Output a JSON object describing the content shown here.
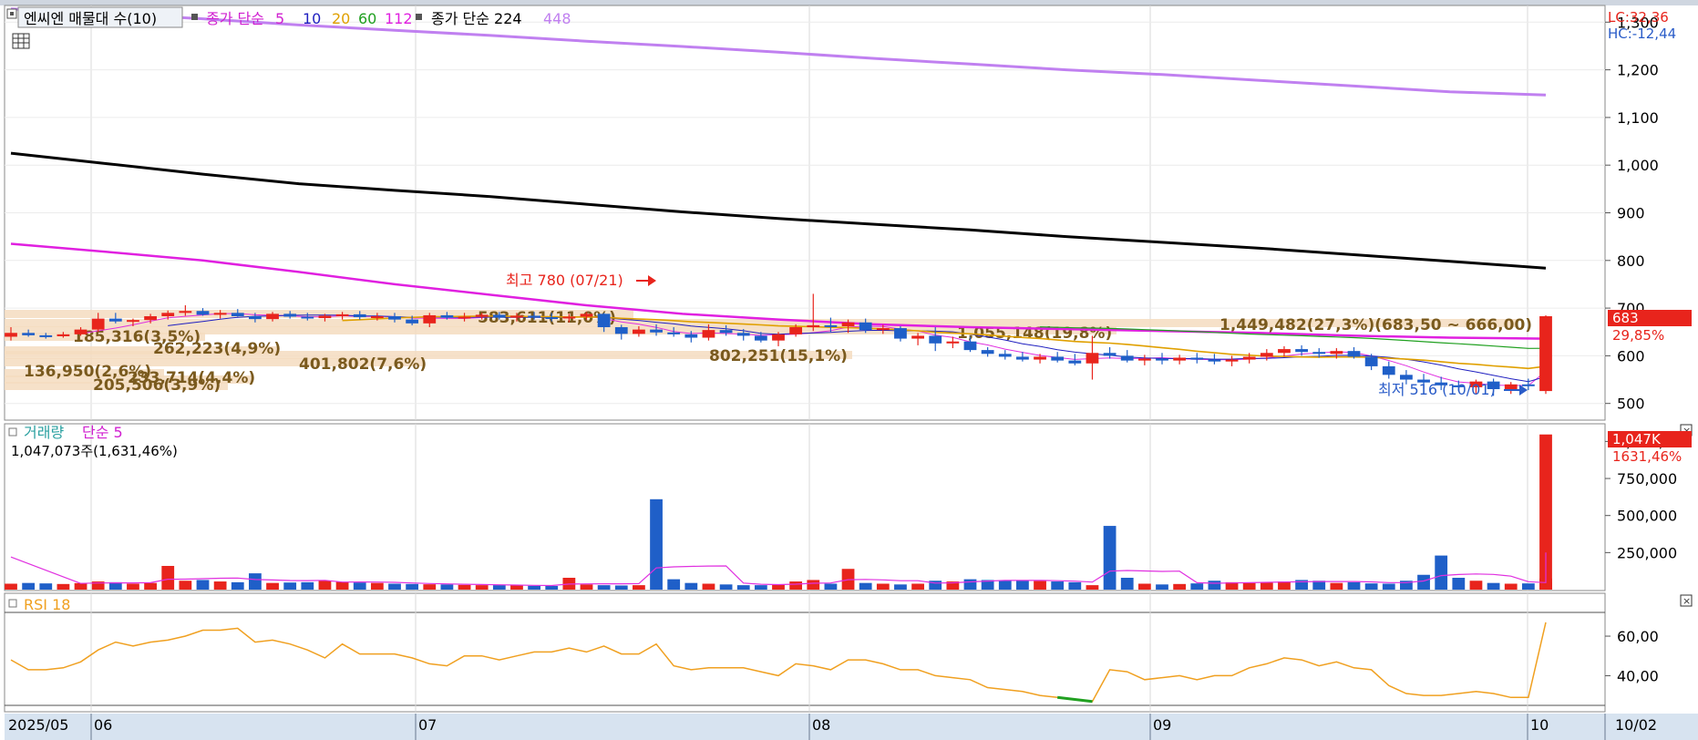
{
  "toolbar": {
    "price_title": "엔씨엔 매물대 수(10)",
    "ma_short_label": "종가 단순",
    "ma_periods": [
      "5",
      "10",
      "20",
      "60",
      "112"
    ],
    "ma_long_label": "종가 단순 224",
    "ma_long2": "448",
    "volume_title": "거래량",
    "volume_ma": "단순 5",
    "volume_info": "1,047,073주(1,631,46%)",
    "rsi_title": "RSI 18"
  },
  "readouts": {
    "lc": "LC:32,36",
    "hc": "HC:-12,44",
    "price_tag": "683",
    "price_pct": "29,85%",
    "volume_tag": "1,047K",
    "volume_pct": "1631,46%"
  },
  "colors": {
    "up": "#e8241c",
    "down": "#1f5fc8",
    "ma5": "#e030e0",
    "ma10": "#2020c0",
    "ma20": "#e0a000",
    "ma60": "#20a020",
    "ma112": "#e020e0",
    "ma224": "#000000",
    "ma448": "#c080f0",
    "rsi": "#f0a020",
    "profile": "#f5dcc0",
    "profile_label": "#7a5a1e",
    "tag": "#e8241c"
  },
  "chart_data": [
    {
      "type": "candlestick",
      "title": "엔씨엔",
      "x_axis_labels": [
        "2025/05",
        "06",
        "07",
        "08",
        "09",
        "10"
      ],
      "date_readout": "10/02",
      "ylim": [
        465,
        1335
      ],
      "y_ticks": [
        500,
        600,
        700,
        800,
        900,
        1000,
        1100,
        1200,
        1300
      ],
      "y_tick_labels": [
        "500",
        "600",
        "700",
        "800",
        "900",
        "1,000",
        "1,100",
        "1,200",
        "1,300"
      ],
      "candles": [
        [
          640,
          660,
          632,
          648
        ],
        [
          648,
          655,
          640,
          643
        ],
        [
          643,
          648,
          636,
          641
        ],
        [
          641,
          650,
          638,
          645
        ],
        [
          645,
          660,
          642,
          655
        ],
        [
          655,
          690,
          650,
          678
        ],
        [
          678,
          690,
          668,
          672
        ],
        [
          672,
          678,
          662,
          675
        ],
        [
          675,
          688,
          668,
          683
        ],
        [
          683,
          695,
          676,
          690
        ],
        [
          690,
          706,
          684,
          694
        ],
        [
          694,
          700,
          684,
          686
        ],
        [
          686,
          696,
          678,
          690
        ],
        [
          690,
          698,
          682,
          683
        ],
        [
          683,
          690,
          670,
          677
        ],
        [
          677,
          692,
          672,
          688
        ],
        [
          688,
          694,
          678,
          682
        ],
        [
          682,
          690,
          674,
          679
        ],
        [
          679,
          688,
          672,
          684
        ],
        [
          684,
          692,
          676,
          687
        ],
        [
          687,
          694,
          676,
          681
        ],
        [
          681,
          690,
          674,
          683
        ],
        [
          683,
          690,
          670,
          676
        ],
        [
          676,
          684,
          664,
          668
        ],
        [
          668,
          690,
          660,
          685
        ],
        [
          685,
          692,
          676,
          680
        ],
        [
          680,
          690,
          672,
          682
        ],
        [
          682,
          690,
          676,
          686
        ],
        [
          686,
          692,
          676,
          680
        ],
        [
          680,
          690,
          672,
          684
        ],
        [
          684,
          692,
          676,
          681
        ],
        [
          681,
          690,
          672,
          679
        ],
        [
          679,
          688,
          670,
          682
        ],
        [
          682,
          692,
          676,
          688
        ],
        [
          688,
          690,
          650,
          660
        ],
        [
          660,
          665,
          634,
          646
        ],
        [
          646,
          662,
          640,
          655
        ],
        [
          655,
          666,
          642,
          649
        ],
        [
          649,
          660,
          640,
          645
        ],
        [
          645,
          652,
          628,
          638
        ],
        [
          638,
          666,
          632,
          654
        ],
        [
          654,
          664,
          642,
          648
        ],
        [
          648,
          656,
          632,
          642
        ],
        [
          642,
          650,
          628,
          632
        ],
        [
          632,
          650,
          620,
          645
        ],
        [
          645,
          666,
          640,
          660
        ],
        [
          660,
          730,
          652,
          664
        ],
        [
          664,
          680,
          650,
          662
        ],
        [
          662,
          676,
          648,
          670
        ],
        [
          670,
          678,
          648,
          654
        ],
        [
          654,
          665,
          646,
          658
        ],
        [
          658,
          662,
          630,
          636
        ],
        [
          636,
          648,
          622,
          642
        ],
        [
          642,
          660,
          610,
          626
        ],
        [
          626,
          640,
          616,
          630
        ],
        [
          630,
          640,
          608,
          612
        ],
        [
          612,
          618,
          598,
          604
        ],
        [
          604,
          612,
          592,
          598
        ],
        [
          598,
          608,
          588,
          592
        ],
        [
          592,
          604,
          584,
          598
        ],
        [
          598,
          608,
          586,
          590
        ],
        [
          590,
          604,
          580,
          584
        ],
        [
          584,
          642,
          550,
          606
        ],
        [
          606,
          618,
          594,
          600
        ],
        [
          600,
          612,
          586,
          590
        ],
        [
          590,
          602,
          580,
          594
        ],
        [
          594,
          606,
          582,
          590
        ],
        [
          590,
          602,
          582,
          596
        ],
        [
          596,
          606,
          584,
          592
        ],
        [
          592,
          604,
          582,
          588
        ],
        [
          588,
          600,
          578,
          592
        ],
        [
          592,
          606,
          584,
          598
        ],
        [
          598,
          614,
          590,
          606
        ],
        [
          606,
          620,
          598,
          614
        ],
        [
          614,
          622,
          600,
          608
        ],
        [
          608,
          616,
          596,
          604
        ],
        [
          604,
          616,
          594,
          610
        ],
        [
          610,
          618,
          594,
          598
        ],
        [
          598,
          604,
          570,
          578
        ],
        [
          578,
          588,
          552,
          560
        ],
        [
          560,
          570,
          540,
          550
        ],
        [
          550,
          562,
          530,
          544
        ],
        [
          544,
          556,
          528,
          538
        ],
        [
          538,
          548,
          526,
          534
        ],
        [
          534,
          550,
          520,
          546
        ],
        [
          546,
          552,
          516,
          530
        ],
        [
          530,
          545,
          520,
          540
        ],
        [
          540,
          552,
          528,
          538
        ],
        [
          526,
          685,
          520,
          683
        ]
      ],
      "highest_label": "최고 780 (07/21)",
      "lowest_label": "최저 516 (10/01)",
      "moving_averages": [
        {
          "name": "112",
          "values": [
            835,
            818,
            800,
            776,
            750,
            728,
            706,
            688,
            676,
            666,
            660,
            656,
            652,
            648,
            642,
            638,
            636
          ]
        },
        {
          "name": "224",
          "values": [
            1025,
            1003,
            981,
            961,
            947,
            934,
            918,
            902,
            888,
            876,
            864,
            850,
            838,
            826,
            812,
            798,
            784
          ]
        },
        {
          "name": "448",
          "values": [
            1328,
            1318,
            1307,
            1294,
            1283,
            1272,
            1260,
            1249,
            1237,
            1224,
            1212,
            1200,
            1190,
            1178,
            1166,
            1154,
            1147
          ]
        }
      ],
      "volume_profile": [
        {
          "label": "136,950(2,6%)",
          "price": 540
        },
        {
          "label": "205,506(3,9%)",
          "price": 540
        },
        {
          "label": "233,714(4,4%)",
          "price": 540
        },
        {
          "label": "262,223(4,9%)",
          "price": 620
        },
        {
          "label": "185,316(3,5%)",
          "price": 655
        },
        {
          "label": "401,802(7,6%)",
          "price": 600
        },
        {
          "label": "583,611(11,0%)",
          "price": 690
        },
        {
          "label": "802,251(15,1%)",
          "price": 625
        },
        {
          "label": "1,055,148(19,8%)",
          "price": 662
        },
        {
          "label": "1,449,482(27,3%)(683,50 ~ 666,00)",
          "price": 677
        }
      ]
    },
    {
      "type": "bar",
      "title": "거래량",
      "ylim": [
        0,
        1150000
      ],
      "y_ticks": [
        250000,
        500000,
        750000,
        1000000
      ],
      "y_tick_labels": [
        "250,000",
        "500,000",
        "750,000",
        "1,000,000"
      ],
      "values": [
        40000,
        45000,
        42000,
        38000,
        44000,
        55000,
        50000,
        40000,
        45000,
        160000,
        60000,
        65000,
        55000,
        50000,
        110000,
        45000,
        48000,
        50000,
        60000,
        52000,
        48000,
        45000,
        40000,
        38000,
        36000,
        35000,
        32000,
        30000,
        30000,
        28000,
        26000,
        25000,
        80000,
        35000,
        30000,
        28000,
        30000,
        610000,
        70000,
        45000,
        40000,
        35000,
        30000,
        30000,
        35000,
        55000,
        65000,
        40000,
        140000,
        45000,
        40000,
        35000,
        40000,
        60000,
        55000,
        70000,
        65000,
        60000,
        62000,
        58000,
        55000,
        50000,
        30000,
        430000,
        80000,
        40000,
        35000,
        38000,
        42000,
        60000,
        50000,
        45000,
        48000,
        55000,
        65000,
        60000,
        45000,
        50000,
        42000,
        40000,
        60000,
        100000,
        230000,
        80000,
        60000,
        45000,
        40000,
        42000,
        50000,
        75000,
        1047073
      ]
    },
    {
      "type": "line",
      "title": "RSI 18",
      "ylim": [
        25,
        72
      ],
      "y_ticks": [
        40,
        60
      ],
      "y_tick_labels": [
        "40,00",
        "60,00"
      ],
      "values": [
        48,
        43,
        43,
        44,
        47,
        53,
        57,
        55,
        57,
        58,
        60,
        63,
        63,
        64,
        57,
        58,
        56,
        53,
        49,
        56,
        51,
        51,
        51,
        49,
        46,
        45,
        50,
        50,
        48,
        50,
        52,
        52,
        54,
        52,
        55,
        51,
        51,
        56,
        45,
        43,
        44,
        44,
        44,
        42,
        40,
        46,
        45,
        43,
        48,
        48,
        46,
        43,
        43,
        40,
        39,
        38,
        34,
        33,
        32,
        30,
        29,
        28,
        27,
        43,
        42,
        38,
        39,
        40,
        38,
        40,
        40,
        44,
        46,
        49,
        48,
        45,
        47,
        44,
        43,
        35,
        31,
        30,
        30,
        31,
        32,
        31,
        29,
        29,
        67
      ]
    }
  ]
}
